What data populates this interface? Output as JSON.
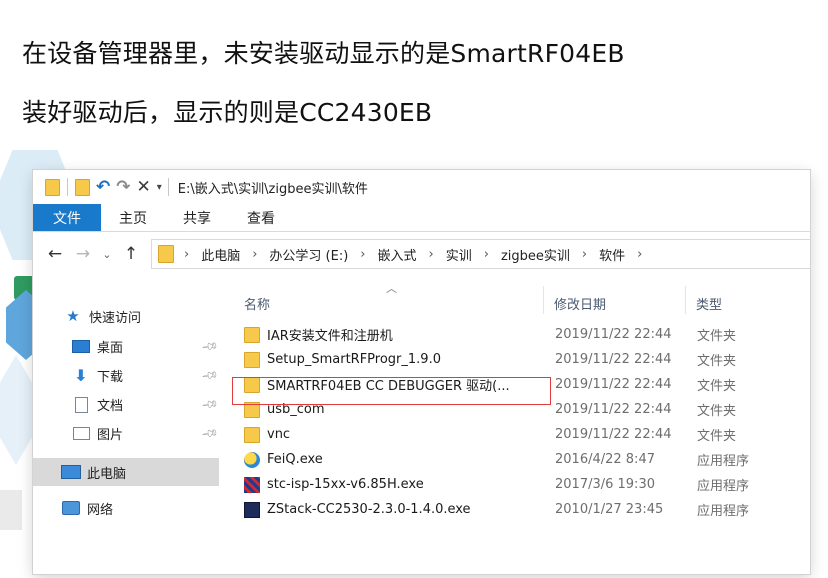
{
  "slide": {
    "line1": "在设备管理器里，未安装驱动显示的是SmartRF04EB",
    "line2": "装好驱动后，显示的则是CC2430EB"
  },
  "window": {
    "title_path": "E:\\嵌入式\\实训\\zigbee实训\\软件",
    "ribbon_tabs": [
      "文件",
      "主页",
      "共享",
      "查看"
    ],
    "breadcrumb": [
      "此电脑",
      "办公学习 (E:)",
      "嵌入式",
      "实训",
      "zigbee实训",
      "软件"
    ],
    "nav": {
      "quick_access": "快速访问",
      "items": [
        "桌面",
        "下载",
        "文档",
        "图片"
      ],
      "this_pc": "此电脑",
      "network": "网络"
    },
    "columns": {
      "name": "名称",
      "date": "修改日期",
      "type": "类型"
    },
    "files": [
      {
        "name": "IAR安装文件和注册机",
        "date": "2019/11/22 22:44",
        "type": "文件夹",
        "icon": "folder-icon"
      },
      {
        "name": "Setup_SmartRFProgr_1.9.0",
        "date": "2019/11/22 22:44",
        "type": "文件夹",
        "icon": "folder-icon"
      },
      {
        "name": "SMARTRF04EB CC DEBUGGER 驱动(...",
        "date": "2019/11/22 22:44",
        "type": "文件夹",
        "icon": "folder-icon"
      },
      {
        "name": "usb_com",
        "date": "2019/11/22 22:44",
        "type": "文件夹",
        "icon": "folder-icon"
      },
      {
        "name": "vnc",
        "date": "2019/11/22 22:44",
        "type": "文件夹",
        "icon": "folder-icon"
      },
      {
        "name": "FeiQ.exe",
        "date": "2016/4/22 8:47",
        "type": "应用程序",
        "icon": "feiq-app-icon"
      },
      {
        "name": "stc-isp-15xx-v6.85H.exe",
        "date": "2017/3/6 19:30",
        "type": "应用程序",
        "icon": "stc-isp-app-icon"
      },
      {
        "name": "ZStack-CC2530-2.3.0-1.4.0.exe",
        "date": "2010/1/27 23:45",
        "type": "应用程序",
        "icon": "zstack-app-icon"
      }
    ],
    "highlighted_row": 2
  },
  "colors": {
    "ribbon_file_tab": "#1979ca",
    "folder": "#f7c94a",
    "highlight_box": "#e23b3b",
    "selected_nav": "#d9d9d9"
  }
}
